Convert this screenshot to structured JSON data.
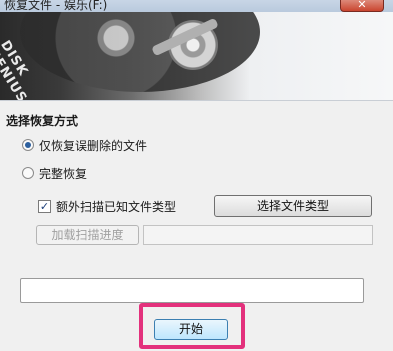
{
  "window": {
    "title": "恢复文件 - 娱乐(F:)",
    "close_label": "✕"
  },
  "banner": {
    "logo_line1": "DISK",
    "logo_line2": "GENIUS"
  },
  "recovery_mode": {
    "title": "选择恢复方式",
    "options": [
      {
        "label": "仅恢复误删除的文件",
        "selected": true
      },
      {
        "label": "完整恢复",
        "selected": false
      }
    ]
  },
  "scan_options": {
    "scan_known_types_label": "额外扫描已知文件类型",
    "scan_known_types_checked": true,
    "select_file_types_button": "选择文件类型",
    "load_scan_progress_button": "加载扫描进度",
    "scan_progress_path": ""
  },
  "progress": {
    "text": ""
  },
  "actions": {
    "start_button": "开始"
  },
  "colors": {
    "highlight": "#e3317c",
    "panel_bg": "#f0f0f0",
    "title_bar": "#b9cadd"
  }
}
